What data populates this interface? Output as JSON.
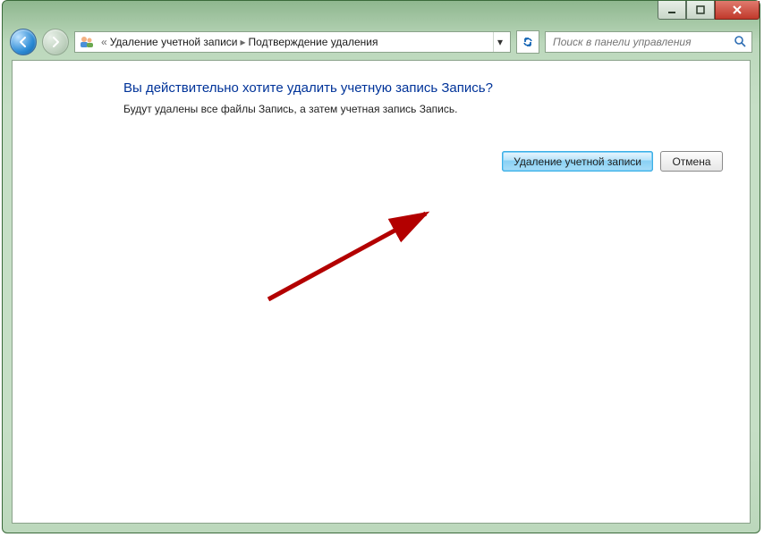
{
  "breadcrumb": [
    "Удаление учетной записи",
    "Подтверждение удаления"
  ],
  "search": {
    "placeholder": "Поиск в панели управления"
  },
  "main": {
    "heading": "Вы действительно хотите удалить учетную запись Запись?",
    "description": "Будут удалены все файлы Запись, а затем учетная запись Запись.",
    "buttons": {
      "delete": "Удаление учетной записи",
      "cancel": "Отмена"
    }
  }
}
